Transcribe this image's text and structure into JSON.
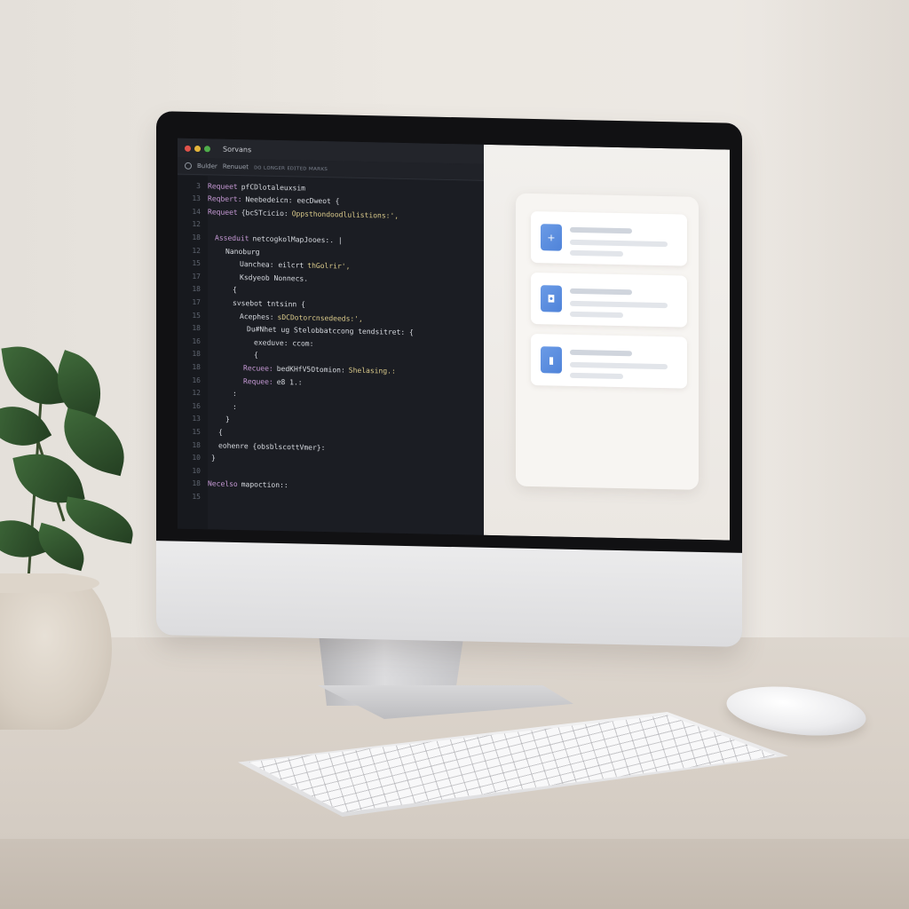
{
  "window": {
    "title": "Sorvans",
    "toolbar_items": [
      "Bulder",
      "Renuuet",
      "ᴅᴏ ʟᴏɴɢᴇʀ ᴇᴅɪᴛᴇᴅ ᴍᴀʀᴋs"
    ]
  },
  "editor": {
    "lines": [
      {
        "n": "3",
        "kw": "Requeet",
        "tx": "pfCDlotaleuxsim",
        "st": ""
      },
      {
        "n": "13",
        "kw": "Reqbert:",
        "tx": "Neebedeicn: eecDweot {",
        "st": ""
      },
      {
        "n": "14",
        "kw": "Requeet",
        "tx": "{bcSTcicio:",
        "st": "Oppsthondoodlulistions:',"
      },
      {
        "n": "12",
        "kw": "",
        "tx": "",
        "st": ""
      },
      {
        "n": "18",
        "kw": "Asseduit",
        "tx": "netcogkolMapJooes:. |",
        "st": ""
      },
      {
        "n": "12",
        "kw": "",
        "tx": "Nanoburg",
        "st": ""
      },
      {
        "n": "15",
        "kw": "",
        "tx": "Uanchea: eilcrt",
        "st": "thGolrir',"
      },
      {
        "n": "17",
        "kw": "",
        "tx": "Ksdyeob Nonnecs.",
        "st": ""
      },
      {
        "n": "18",
        "kw": "",
        "tx": "{",
        "st": ""
      },
      {
        "n": "17",
        "kw": "",
        "tx": "svsebot tntsinn {",
        "st": ""
      },
      {
        "n": "15",
        "kw": "",
        "tx": "Acephes:",
        "st": "sDCDotorcnsedeeds:',"
      },
      {
        "n": "18",
        "kw": "",
        "tx": "Du#Nhet ug Stelobbatccong tendsitret: {",
        "st": ""
      },
      {
        "n": "16",
        "kw": "",
        "tx": "exeduve: ccom:",
        "st": ""
      },
      {
        "n": "18",
        "kw": "",
        "tx": "{",
        "st": ""
      },
      {
        "n": "18",
        "kw": "Recuee:",
        "tx": "bedKHfV5Otomion:",
        "st": "Shelasing.:"
      },
      {
        "n": "16",
        "kw": "Requee:",
        "tx": "e8 1.:",
        "st": ""
      },
      {
        "n": "12",
        "kw": "",
        "tx": ":",
        "st": ""
      },
      {
        "n": "16",
        "kw": "",
        "tx": ":",
        "st": ""
      },
      {
        "n": "13",
        "kw": "",
        "tx": "}",
        "st": ""
      },
      {
        "n": "15",
        "kw": "",
        "tx": "{",
        "st": ""
      },
      {
        "n": "18",
        "kw": "",
        "tx": "eohenre {obsblscottVmer}:",
        "st": ""
      },
      {
        "n": "10",
        "kw": "",
        "tx": "}",
        "st": ""
      },
      {
        "n": "10",
        "kw": "",
        "tx": "",
        "st": ""
      },
      {
        "n": "18",
        "kw": "Necelso",
        "tx": "mapoction::",
        "st": ""
      },
      {
        "n": "15",
        "kw": "",
        "tx": "",
        "st": ""
      }
    ]
  },
  "preview": {
    "cards": [
      {
        "icon": "plus-icon",
        "glyph": "+"
      },
      {
        "icon": "chat-icon",
        "glyph": "◘"
      },
      {
        "icon": "document-icon",
        "glyph": "▮"
      }
    ]
  },
  "colors": {
    "editor_bg": "#1b1d23",
    "keyword": "#c79ad6",
    "string": "#d9c98a",
    "accent": "#4f83d9"
  }
}
